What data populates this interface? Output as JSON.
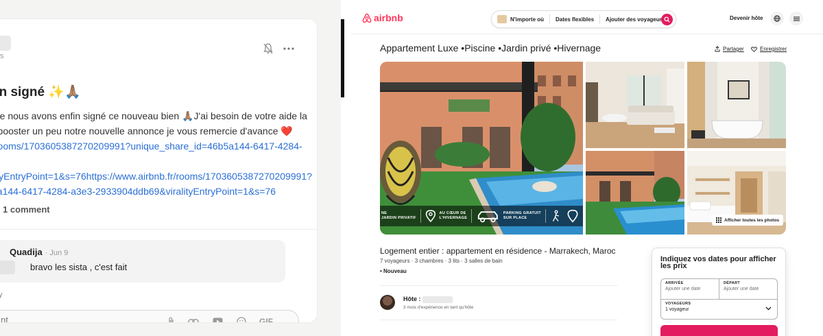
{
  "left_panel": {
    "meta_fragment": "s",
    "post_title": "en signé ✨🙏🏽",
    "body_lines": [
      "nte nous avons enfin signé ce nouveau bien 🙏🏽J'ai besoin de votre aide la",
      "r booster un peu notre nouvelle annonce je vous remercie d'avance ❤️"
    ],
    "link_lines": [
      "/rooms/1703605387270209991?unique_share_id=46b5a144-6417-4284-",
      "",
      "lityEntryPoint=1&s=76https://www.airbnb.fr/rooms/1703605387270209991?",
      "5a144-6417-4284-a3e3-2933904ddb69&viralityEntryPoint=1&s=76"
    ],
    "comments_count_label": "1 comment",
    "comment": {
      "author": "Quadija",
      "date": "· Jun 9",
      "text": "bravo les sista , c'est fait"
    },
    "reply_fragment": "y",
    "comment_input_placeholder": "nt",
    "input_icons": [
      "paperclip-icon",
      "link-icon",
      "video-icon",
      "emoji-icon",
      "gif-icon"
    ],
    "gif_label": "GIF"
  },
  "airbnb": {
    "brand": "airbnb",
    "brand_color": "#ff385c",
    "search": {
      "anywhere": "N'importe où",
      "dates": "Dates flexibles",
      "guests": "Ajouter des voyageurs"
    },
    "host_cta": "Devenir hôte",
    "listing_title": "Appartement Luxe •Piscine •Jardin privé •Hivernage",
    "share_label": "Partager",
    "save_label": "Enregistrer",
    "overlay_items": [
      "NE\nJARDIN PRIVATIF",
      "AU CŒUR DE\nL'HIVERNAGE",
      "PARKING GRATUIT\nSUR PLACE"
    ],
    "show_all_photos": "Afficher toutes les photos",
    "subtitle": "Logement entier : appartement en résidence - Marrakech, Maroc",
    "details": "7 voyageurs · 3 chambres · 3 lits · 3 salles de bain",
    "new_badge": "• Nouveau",
    "host_label": "Hôte :",
    "host_experience": "3 mois d'expérience en tant qu'hôte",
    "booking": {
      "title": "Indiquez vos dates pour afficher les prix",
      "arrival_label": "ARRIVÉE",
      "arrival_placeholder": "Ajouter une date",
      "departure_label": "DÉPART",
      "departure_placeholder": "Ajouter une date",
      "guests_label": "VOYAGEURS",
      "guests_value": "1 voyageur"
    }
  }
}
